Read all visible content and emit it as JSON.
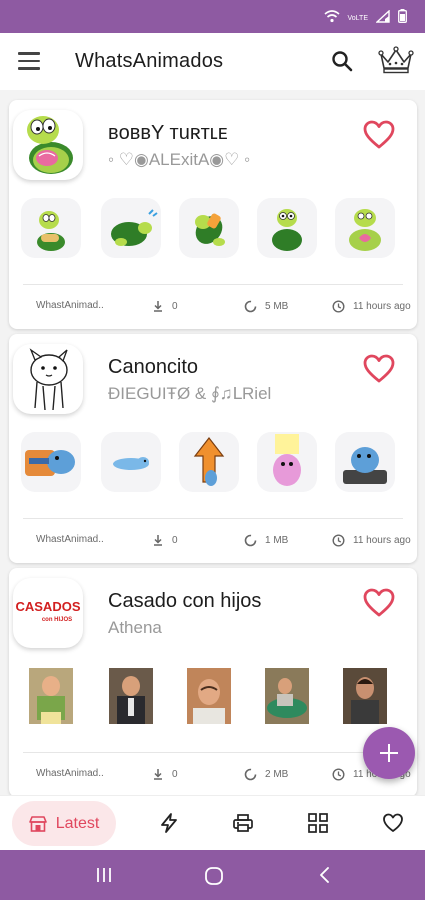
{
  "app": {
    "title": "WhatsAnimados"
  },
  "theme": {
    "primary": "#8e5aa2",
    "accent": "#e0475e",
    "fab": "#9b59b0"
  },
  "status_bar": {
    "icons": [
      "wifi-icon",
      "volte-icon",
      "signal-icon",
      "battery-icon"
    ],
    "network_label": "Wi-Fi"
  },
  "cards": [
    {
      "name": "ʙᴏʙʙY ᴛuʀᴛʟᴇ",
      "author": "◦ ♡◉ALExitA◉♡ ◦",
      "publisher": "WhastAnimad..",
      "downloads": "0",
      "size": "5 MB",
      "updated": "11 hours ago"
    },
    {
      "name": "Canoncito",
      "author": "ĐIEGUIŦØ & ∮♫ᒪRiel",
      "publisher": "WhastAnimad..",
      "downloads": "0",
      "size": "1 MB",
      "updated": "11 hours ago"
    },
    {
      "name": "Casado con hijos",
      "author": "Athena",
      "publisher": "WhastAnimad..",
      "downloads": "0",
      "size": "2 MB",
      "updated": "11 hours ago"
    }
  ],
  "casados_logo": {
    "line1": "CASADOS",
    "line2": "con HIJOS"
  },
  "bottom_nav": {
    "latest_label": "Latest",
    "icons": [
      "store-icon",
      "bolt-icon",
      "printer-icon",
      "grid-icon",
      "heart-icon"
    ]
  },
  "fab": {
    "icon": "plus-icon"
  }
}
